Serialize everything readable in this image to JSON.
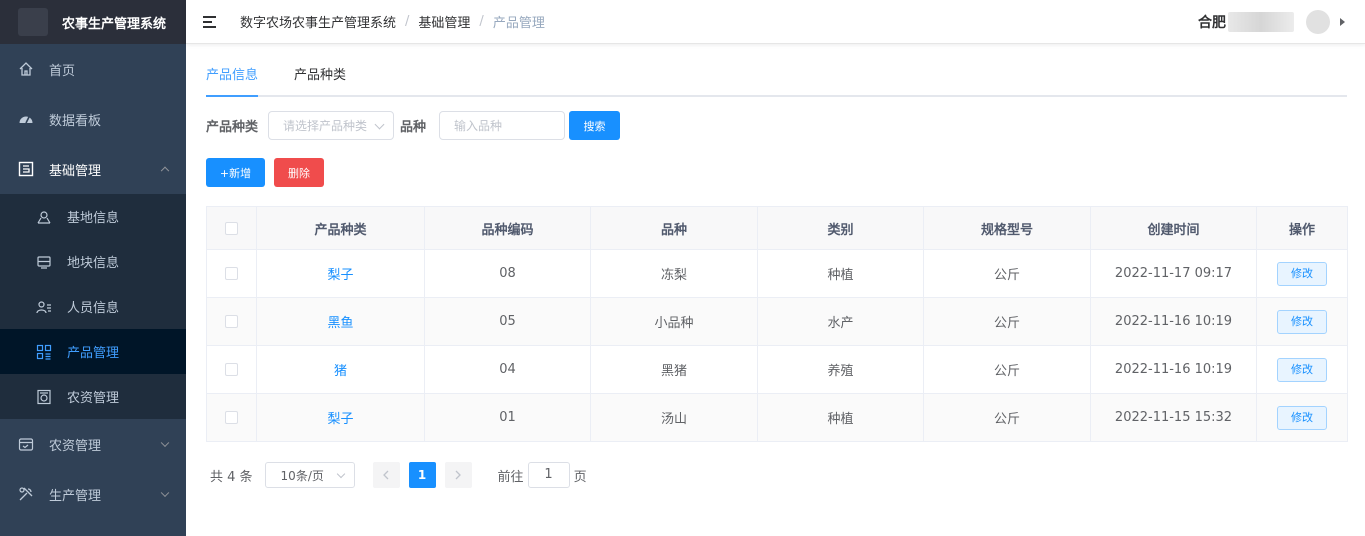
{
  "app": {
    "title": "农事生产管理系统"
  },
  "sidebar": {
    "items": [
      {
        "label": "首页"
      },
      {
        "label": "数据看板"
      },
      {
        "label": "基础管理"
      },
      {
        "label": "农资管理"
      },
      {
        "label": "生产管理"
      }
    ],
    "sub_items": [
      {
        "label": "基地信息"
      },
      {
        "label": "地块信息"
      },
      {
        "label": "人员信息"
      },
      {
        "label": "产品管理"
      },
      {
        "label": "农资管理"
      }
    ]
  },
  "header": {
    "breadcrumb": [
      "数字农场农事生产管理系统",
      "基础管理",
      "产品管理"
    ],
    "user_name": "合肥"
  },
  "tabs": [
    "产品信息",
    "产品种类"
  ],
  "search": {
    "type_label": "产品种类",
    "type_placeholder": "请选择产品种类",
    "variety_label": "品种",
    "variety_placeholder": "输入品种",
    "search_button": "搜索"
  },
  "actions": {
    "add": "+新增",
    "delete": "删除"
  },
  "table": {
    "columns": [
      "产品种类",
      "品种编码",
      "品种",
      "类别",
      "规格型号",
      "创建时间",
      "操作"
    ],
    "rows": [
      {
        "type": "梨子",
        "code": "08",
        "variety": "冻梨",
        "category": "种植",
        "spec": "公斤",
        "created": "2022-11-17 09:17",
        "action": "修改"
      },
      {
        "type": "黑鱼",
        "code": "05",
        "variety": "小品种",
        "category": "水产",
        "spec": "公斤",
        "created": "2022-11-16 10:19",
        "action": "修改"
      },
      {
        "type": "猪",
        "code": "04",
        "variety": "黑猪",
        "category": "养殖",
        "spec": "公斤",
        "created": "2022-11-16 10:19",
        "action": "修改"
      },
      {
        "type": "梨子",
        "code": "01",
        "variety": "汤山",
        "category": "种植",
        "spec": "公斤",
        "created": "2022-11-15 15:32",
        "action": "修改"
      }
    ]
  },
  "pagination": {
    "total": "共 4 条",
    "page_size": "10条/页",
    "current_page": "1",
    "goto_label": "前往",
    "goto_value": "1",
    "unit": "页"
  }
}
